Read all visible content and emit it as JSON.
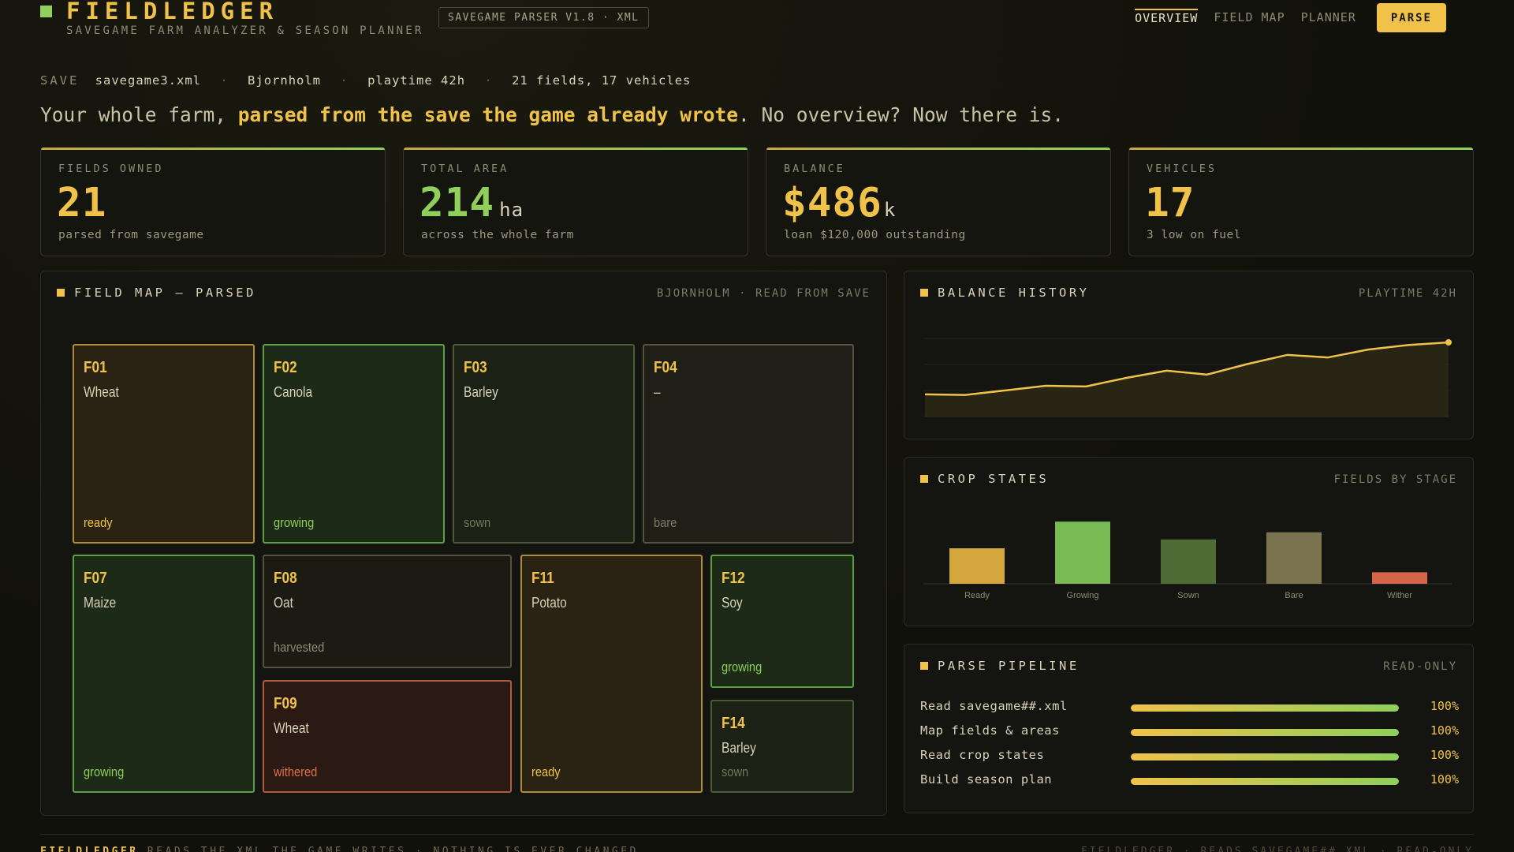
{
  "app": {
    "title": "FIELDLEDGER",
    "subtitle": "SAVEGAME FARM ANALYZER & SEASON PLANNER",
    "version_badge": "SAVEGAME PARSER V1.8 · XML"
  },
  "nav": {
    "items": [
      "OVERVIEW",
      "FIELD MAP",
      "PLANNER"
    ],
    "active": "OVERVIEW",
    "parse_label": "PARSE"
  },
  "save": {
    "label": "SAVE",
    "file": "savegame3.xml",
    "map": "Bjornholm",
    "playtime": "playtime 42h",
    "counts": "21 fields, 17 vehicles",
    "separator": "·"
  },
  "headline": {
    "pre": "Your whole farm, ",
    "bold": "parsed from the save the game already wrote",
    "post": ". No overview? Now there is."
  },
  "stats": [
    {
      "label": "FIELDS OWNED",
      "value": "21",
      "unit": "",
      "note": "parsed from savegame"
    },
    {
      "label": "TOTAL AREA",
      "value": "214",
      "unit": "ha",
      "note": "across the whole farm"
    },
    {
      "label": "BALANCE",
      "value": "$486",
      "unit": "k",
      "note": "loan $120,000 outstanding"
    },
    {
      "label": "VEHICLES",
      "value": "17",
      "unit": "",
      "note": "3 low on fuel"
    }
  ],
  "field_map": {
    "title": "FIELD MAP — PARSED",
    "tag": "BJORNHOLM · READ FROM SAVE",
    "fields": [
      {
        "id": "F01",
        "crop": "Wheat",
        "state": "ready"
      },
      {
        "id": "F02",
        "crop": "Canola",
        "state": "growing"
      },
      {
        "id": "F03",
        "crop": "Barley",
        "state": "sown"
      },
      {
        "id": "F04",
        "crop": "–",
        "state": "bare"
      },
      {
        "id": "F07",
        "crop": "Maize",
        "state": "growing"
      },
      {
        "id": "F08",
        "crop": "Oat",
        "state": "harvested"
      },
      {
        "id": "F09",
        "crop": "Wheat",
        "state": "withered"
      },
      {
        "id": "F11",
        "crop": "Potato",
        "state": "ready"
      },
      {
        "id": "F12",
        "crop": "Soy",
        "state": "growing"
      },
      {
        "id": "F14",
        "crop": "Barley",
        "state": "sown"
      }
    ]
  },
  "balance_history": {
    "title": "BALANCE HISTORY",
    "tag": "PLAYTIME 42H",
    "values": [
      0.35,
      0.34,
      0.41,
      0.48,
      0.47,
      0.6,
      0.71,
      0.65,
      0.81,
      0.95,
      0.91,
      1.03,
      1.1,
      1.14
    ],
    "line_color": "#f0c24a"
  },
  "crop_states": {
    "title": "CROP STATES",
    "tag": "FIELDS BY STAGE"
  },
  "chart_data": {
    "type": "bar",
    "categories": [
      "Ready",
      "Growing",
      "Sown",
      "Bare",
      "Wither"
    ],
    "values": [
      4,
      7,
      5,
      5.8,
      1.3
    ],
    "colors": [
      "#d4a73e",
      "#78bb55",
      "#4f6b36",
      "#7c7350",
      "#d2654a"
    ],
    "ylim": [
      0,
      8
    ]
  },
  "pipeline": {
    "title": "PARSE PIPELINE",
    "tag": "READ-ONLY",
    "steps": [
      {
        "label": "Read savegame##.xml",
        "pct": "100%",
        "value": 1
      },
      {
        "label": "Map fields & areas",
        "pct": "100%",
        "value": 1
      },
      {
        "label": "Read crop states",
        "pct": "100%",
        "value": 1
      },
      {
        "label": "Build season plan",
        "pct": "100%",
        "value": 1
      }
    ]
  },
  "footer": {
    "brand": "FIELDLEDGER",
    "left": "READS THE XML THE GAME WRITES · NOTHING IS EVER CHANGED",
    "right": "FIELDLEDGER · READS SAVEGAME##.XML · READ-ONLY"
  },
  "colors": {
    "accent": "#f0c24a",
    "green": "#8fcf5a",
    "background": "#11110b"
  }
}
